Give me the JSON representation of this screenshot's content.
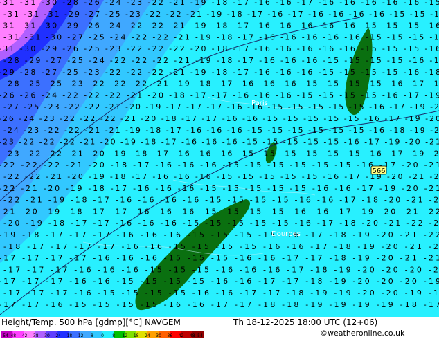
{
  "map": {
    "field_colors": {
      "magenta": "#ff80ff",
      "violet": "#b060ff",
      "blue_dark": "#2030ff",
      "blue": "#3c70ff",
      "blue_light": "#40a8ff",
      "sky": "#32c8ff",
      "cyan": "#28f0ff",
      "land_green": "#0a7010"
    },
    "places": [
      {
        "name": "Paris"
      },
      {
        "name": "Dourbes"
      }
    ],
    "station_value": "566",
    "rows": [
      "-31 -31 -30 -28 -26 -24 -23 -22 -21 -19 -18 -17 -16 -16 -17 -16 -16 -16 -16 -16 -15",
      "-31 -31 -31 -29 -27 -25 -23 -22 -22 -21 -19 -18 -17 -16 -17 -16 -16 -16 -16 -15 -15 -16",
      "-31 -31 -30 -29 -26 -24 -22 -22 -21 -19 -18 -17 -16 -16 -16 -16 -16 -15 -15 -15 -16",
      "-31 -31 -30 -27 -25 -24 -22 -22 -21 -19 -18 -17 -16 -16 -16 -16 -16 -15 -15 -15 -16",
      "-31 -30 -29 -26 -25 -23 -22 -22 -22 -20 -18 -17 -16 -16 -16 -16 -16 -15 -15 -15 -16",
      "-28 -29 -27 -25 -24 -22 -22 -22 -21 -19 -18 -17 -16 -16 -16 -15 -15 -15 -15 -16 -17",
      "-29 -28 -27 -25 -23 -22 -22 -22 -21 -19 -18 -17 -16 -16 -16 -15 -15 -15 -15 -16 -18",
      "-28 -25 -25 -23 -22 -22 -22 -21 -19 -18 -17 -16 -16 -16 -15 -15 -15 -15 -16 -17 -18",
      "-26 -26 -24 -22 -22 -22 -21 -20 -18 -17 -17 -16 -16 -16 -15 -15 -15 -15 -16 -17 -19",
      "-27 -25 -23 -22 -22 -21 -20 -19 -17 -17 -17 -16 -16 -15 -15 -15 -15 -15 -16 -17 -19 -20",
      "-26 -24 -23 -22 -22 -22 -21 -20 -18 -17 -17 -16 -16 -15 -15 -15 -15 -15 -16 -17 -19 -20",
      "-24 -23 -22 -22 -21 -21 -19 -18 -17 -16 -16 -16 -15 -15 -15 -15 -15 -15 -16 -18 -19 -20",
      "-23 -22 -22 -22 -21 -20 -19 -18 -17 -16 -16 -16 -15 -15 -15 -15 -15 -16 -17 -19 -20 -21",
      "-23 -22 -22 -21 -20 -19 -18 -17 -16 -16 -16 -15 -15 -15 -15 -15 -15 -16 -17 -19 -21",
      "-22 -22 -22 -21 -20 -18 -17 -16 -16 -16 -15 -15 -15 -15 -15 -15 -16 -17 -20 -21",
      "-22 -22 -21 -20 -19 -18 -17 -16 -16 -16 -15 -15 -15 -15 -15 -16 -17 -19 -20 -21 -22",
      "-22 -21 -20 -19 -18 -17 -16 -16 -16 -15 -15 -15 -15 -15 -16 -16 -17 -19 -20 -21",
      "-22 -21 -19 -18 -17 -16 -16 -16 -16 -15 -15 -15 -15 -16 -16 -17 -18 -20 -21 -22",
      "-21 -20 -19 -18 -17 -17 -16 -16 -16 -15 -15 -15 -15 -16 -16 -17 -19 -20 -21 -22",
      "-20 -19 -18 -17 -17 -16 -16 -16 -15 -15 -15 -15 -15 -16 -17 -18 -20 -21 -22 -22",
      "-19 -18 -17 -17 -17 -16 -16 -16 -15 -15 -15 -15 -16 -17 -18 -19 -20 -21 -22",
      "-18 -17 -17 -17 -17 -16 -16 -15 -15 -15 -15 -16 -16 -17 -18 -19 -20 -21 -21",
      "-17 -17 -17 -17 -16 -16 -16 -15 -15 -15 -16 -16 -17 -17 -18 -19 -20 -21 -21",
      "-17 -17 -17 -16 -16 -16 -15 -15 -15 -16 -16 -16 -17 -18 -19 -20 -20 -20 -21",
      "-17 -17 -17 -16 -16 -15 -15 -15 -15 -16 -16 -17 -17 -18 -19 -20 -20 -20 -19",
      "-17 -17 -17 -16 -15 -15 -15 -15 -16 -16 -17 -17 -18 -19 -19 -20 -20 -19 -19",
      "-17 -17 -16 -15 -15 -15 -15 -16 -16 -17 -17 -18 -18 -19 -19 -19 -19 -18 -17"
    ]
  },
  "footer": {
    "title": "Height/Temp. 500 hPa [gdmp][°C] NAVGEM",
    "valid_time": "Th 18-12-2025 18:00 UTC (12+06)",
    "copyright": "©weatheronline.co.uk",
    "scale_labels": [
      "-54",
      "-48",
      "-42",
      "-38",
      "-30",
      "-24",
      "-18",
      "-12",
      "-8",
      "0",
      "8",
      "12",
      "18",
      "24",
      "30",
      "36",
      "42",
      "48",
      "54"
    ],
    "scale_colors": [
      "#c000c0",
      "#ff40ff",
      "#ff80ff",
      "#b060ff",
      "#6040ff",
      "#2030ff",
      "#3c70ff",
      "#40a8ff",
      "#32c8ff",
      "#28f0ff",
      "#00c000",
      "#80e000",
      "#e0e000",
      "#ffa000",
      "#ff6000",
      "#ff0000",
      "#c00000",
      "#900000"
    ]
  }
}
